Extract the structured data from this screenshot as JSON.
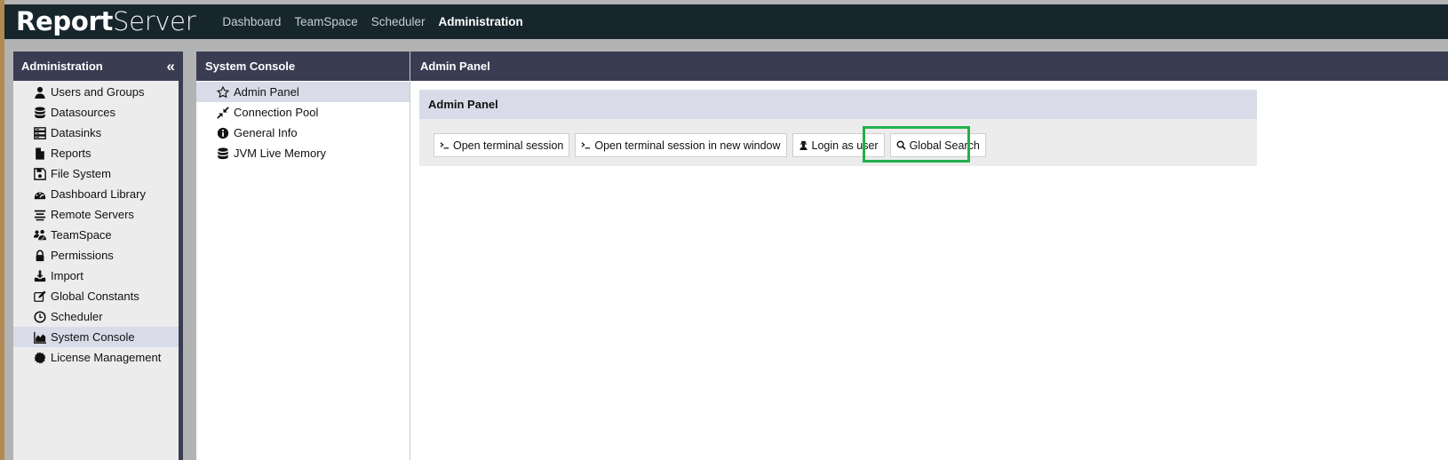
{
  "app": {
    "logo_part1": "Report",
    "logo_part2": "Server"
  },
  "topnav": {
    "items": [
      {
        "label": "Dashboard",
        "active": false
      },
      {
        "label": "TeamSpace",
        "active": false
      },
      {
        "label": "Scheduler",
        "active": false
      },
      {
        "label": "Administration",
        "active": true
      }
    ]
  },
  "left_panel": {
    "title": "Administration",
    "collapse_glyph": "«",
    "items": [
      {
        "label": "Users and Groups",
        "icon": "user-icon"
      },
      {
        "label": "Datasources",
        "icon": "database-icon"
      },
      {
        "label": "Datasinks",
        "icon": "server-icon"
      },
      {
        "label": "Reports",
        "icon": "file-icon"
      },
      {
        "label": "File System",
        "icon": "floppy-icon"
      },
      {
        "label": "Dashboard Library",
        "icon": "gauge-icon"
      },
      {
        "label": "Remote Servers",
        "icon": "remote-server-icon"
      },
      {
        "label": "TeamSpace",
        "icon": "users-icon"
      },
      {
        "label": "Permissions",
        "icon": "lock-icon"
      },
      {
        "label": "Import",
        "icon": "download-icon"
      },
      {
        "label": "Global Constants",
        "icon": "edit-icon"
      },
      {
        "label": "Scheduler",
        "icon": "clock-icon"
      },
      {
        "label": "System Console",
        "icon": "area-chart-icon",
        "selected": true
      },
      {
        "label": "License Management",
        "icon": "certificate-icon"
      }
    ]
  },
  "mid_panel": {
    "title": "System Console",
    "items": [
      {
        "label": "Admin Panel",
        "icon": "star-icon",
        "selected": true
      },
      {
        "label": "Connection Pool",
        "icon": "compress-icon"
      },
      {
        "label": "General Info",
        "icon": "info-icon"
      },
      {
        "label": "JVM Live Memory",
        "icon": "database-icon"
      }
    ]
  },
  "right_panel": {
    "title": "Admin Panel",
    "box_title": "Admin Panel",
    "buttons": [
      {
        "label": "Open terminal session",
        "icon": "terminal-icon"
      },
      {
        "label": "Open terminal session in new window",
        "icon": "terminal-icon"
      },
      {
        "label": "Login as user",
        "icon": "user-secret-icon"
      },
      {
        "label": "Global Search",
        "icon": "search-icon"
      }
    ]
  },
  "colors": {
    "topbar": "#17262d",
    "panel_header": "#3a3d52",
    "selected_row": "#d9dce8",
    "highlight": "#22b04b"
  }
}
